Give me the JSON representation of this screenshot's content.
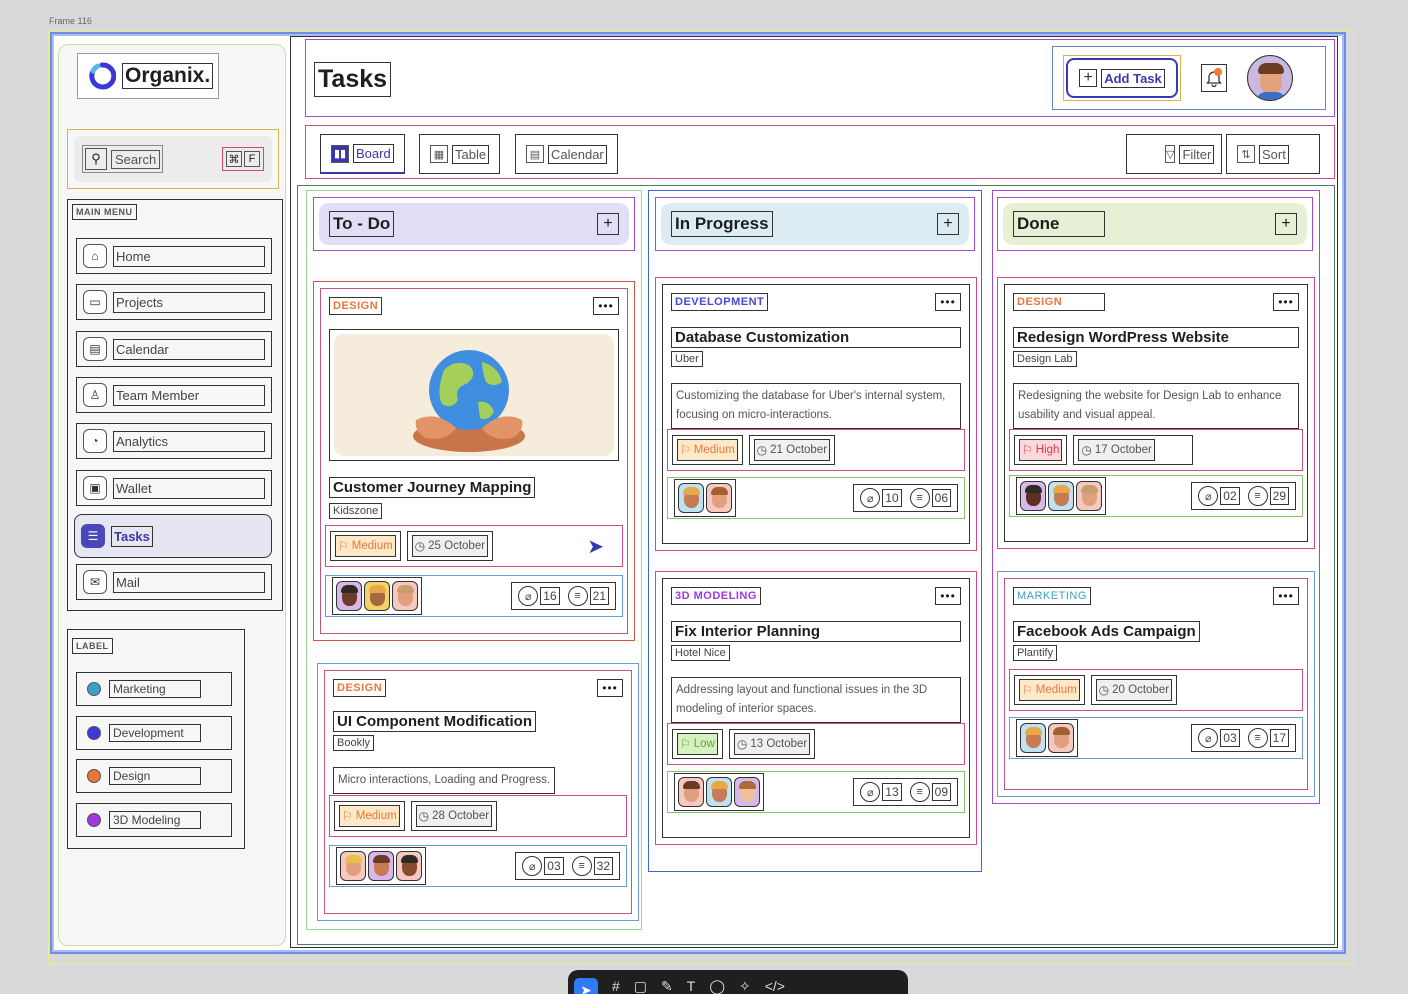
{
  "canvas": {
    "frame_label": "Frame 116"
  },
  "brand": {
    "name": "Organix.",
    "accent": "#3a38a8"
  },
  "search": {
    "placeholder": "Search",
    "shortcut_cmd": "⌘",
    "shortcut_key": "F"
  },
  "main_menu": {
    "title": "MAIN MENU",
    "items": [
      {
        "label": "Home",
        "icon": "home-icon"
      },
      {
        "label": "Projects",
        "icon": "folder-icon"
      },
      {
        "label": "Calendar",
        "icon": "calendar-icon"
      },
      {
        "label": "Team Member",
        "icon": "user-icon"
      },
      {
        "label": "Analytics",
        "icon": "pie-chart-icon"
      },
      {
        "label": "Wallet",
        "icon": "wallet-icon"
      },
      {
        "label": "Tasks",
        "icon": "tasks-icon",
        "active": true
      },
      {
        "label": "Mail",
        "icon": "mail-icon"
      }
    ]
  },
  "labels": {
    "title": "LABEL",
    "items": [
      {
        "label": "Marketing",
        "color": "#3aa0c8"
      },
      {
        "label": "Development",
        "color": "#3d3ad8"
      },
      {
        "label": "Design",
        "color": "#e8773a"
      },
      {
        "label": "3D Modeling",
        "color": "#a236e0"
      }
    ]
  },
  "header": {
    "title": "Tasks",
    "add_task": "Add Task"
  },
  "views": {
    "board": "Board",
    "table": "Table",
    "calendar": "Calendar",
    "filter": "Filter",
    "sort": "Sort"
  },
  "columns": [
    {
      "name": "To - Do",
      "color": "#e3def8",
      "cards": [
        {
          "tag": "DESIGN",
          "tag_color": "#e8773a",
          "title": "Customer Journey Mapping",
          "client": "Kidszone",
          "priority": "Medium",
          "date": "25 October",
          "attachments": "16",
          "comments": "21",
          "image": true
        },
        {
          "tag": "DESIGN",
          "tag_color": "#e8773a",
          "title": "UI Component Modification",
          "client": "Bookly",
          "desc": "Micro interactions, Loading and Progress.",
          "priority": "Medium",
          "date": "28 October",
          "attachments": "03",
          "comments": "32"
        }
      ]
    },
    {
      "name": "In Progress",
      "color": "#dcecf2",
      "cards": [
        {
          "tag": "DEVELOPMENT",
          "tag_color": "#4a46d8",
          "title": "Database Customization",
          "client": "Uber",
          "desc": "Customizing the database for Uber's internal system, focusing on micro-interactions.",
          "priority": "Medium",
          "date": "21 October",
          "attachments": "10",
          "comments": "06"
        },
        {
          "tag": "3D MODELING",
          "tag_color": "#a236e0",
          "title": "Fix Interior Planning",
          "client": "Hotel Nice",
          "desc": "Addressing layout and functional issues in the 3D modeling of interior spaces.",
          "priority": "Low",
          "date": "13 October",
          "attachments": "13",
          "comments": "09"
        }
      ]
    },
    {
      "name": "Done",
      "color": "#e6f0d4",
      "cards": [
        {
          "tag": "DESIGN",
          "tag_color": "#e8773a",
          "title": "Redesign WordPress Website",
          "client": "Design Lab",
          "desc": "Redesigning the website for Design Lab to enhance usability and visual appeal.",
          "priority": "High",
          "date": "17 October",
          "attachments": "02",
          "comments": "29"
        },
        {
          "tag": "MARKETING",
          "tag_color": "#3aa0c8",
          "title": "Facebook Ads Campaign",
          "client": "Plantify",
          "priority": "Medium",
          "date": "20 October",
          "attachments": "03",
          "comments": "17"
        }
      ]
    }
  ]
}
